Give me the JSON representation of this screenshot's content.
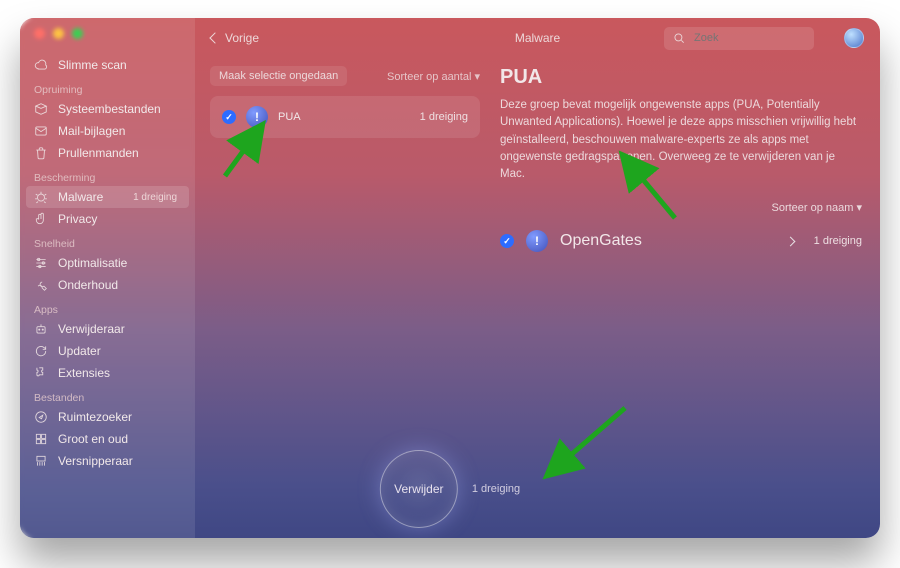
{
  "colors": {
    "accent": "#28c840",
    "check": "#2d6cff"
  },
  "topbar": {
    "back_label": "Vorige",
    "crumb": "Malware",
    "search_placeholder": "Zoek"
  },
  "sidebar": {
    "top_item": "Slimme scan",
    "sections": [
      {
        "title": "Opruiming",
        "items": [
          "Systeembestanden",
          "Mail-bijlagen",
          "Prullenmanden"
        ]
      },
      {
        "title": "Bescherming",
        "items": [
          "Malware",
          "Privacy"
        ],
        "active_index": 0,
        "badge": "1 dreiging"
      },
      {
        "title": "Snelheid",
        "items": [
          "Optimalisatie",
          "Onderhoud"
        ]
      },
      {
        "title": "Apps",
        "items": [
          "Verwijderaar",
          "Updater",
          "Extensies"
        ]
      },
      {
        "title": "Bestanden",
        "items": [
          "Ruimtezoeker",
          "Groot en oud",
          "Versnipperaar"
        ]
      }
    ]
  },
  "mid": {
    "undo_label": "Maak selectie ongedaan",
    "sort_label": "Sorteer op aantal ▾",
    "group_name": "PUA",
    "group_count": "1 dreiging"
  },
  "right": {
    "title": "PUA",
    "description": "Deze groep bevat mogelijk ongewenste apps (PUA, Potentially Unwanted Applications). Hoewel je deze apps misschien vrijwillig hebt geïnstalleerd, beschouwen malware-experts ze als apps met ongewenste gedragspatronen. Overweeg ze te verwijderen van je Mac.",
    "sort_label": "Sorteer op naam ▾",
    "item_name": "OpenGates",
    "item_count": "1 dreiging"
  },
  "action": {
    "btn_label": "Verwijder",
    "sub": "1 dreiging"
  },
  "icons": {
    "smart": "cloud",
    "system": "box",
    "mail": "mail",
    "trash": "trash",
    "malware": "bug",
    "privacy": "hand",
    "optim": "sliders",
    "maint": "wrench",
    "uninst": "robot",
    "updater": "refresh",
    "ext": "puzzle",
    "space": "compass",
    "large": "grid",
    "shred": "shred",
    "search": "search"
  }
}
